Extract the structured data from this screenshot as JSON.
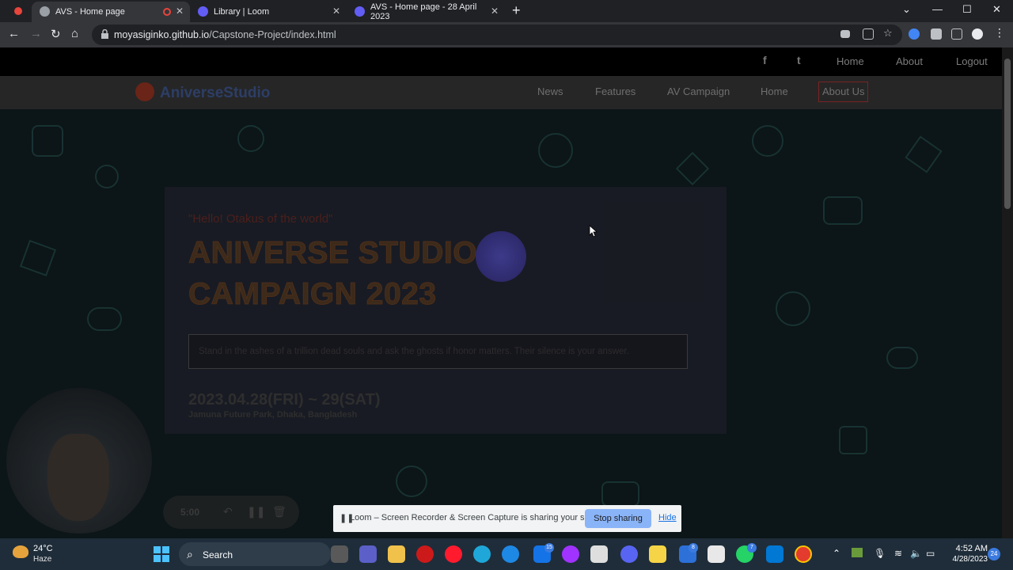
{
  "browser": {
    "tabs": [
      {
        "title": "AVS - Home page",
        "active": true
      },
      {
        "title": "Library | Loom",
        "active": false
      },
      {
        "title": "AVS - Home page - 28 April 2023",
        "active": false
      }
    ],
    "url_host": "moyasiginko.github.io",
    "url_path": "/Capstone-Project/index.html"
  },
  "site": {
    "topbar": {
      "social": [
        "f",
        "t"
      ],
      "links": [
        "Home",
        "About",
        "Logout"
      ]
    },
    "brand": "AniverseStudio",
    "nav": [
      "News",
      "Features",
      "AV Campaign",
      "Home",
      "About Us"
    ],
    "hero": {
      "greeting": "\"Hello! Otakus of the world\"",
      "title_line1": "ANIVERSE STUDIO",
      "title_line2": "CAMPAIGN 2023",
      "quote": "Stand in the ashes of a trillion dead souls and ask the ghosts if honor matters. Their silence is your answer.",
      "date": "2023.04.28(FRI) ~ 29(SAT)",
      "location": "Jamuna Future Park, Dhaka, Bangladesh"
    }
  },
  "loom": {
    "timer": "5:00",
    "share_message": "Loom – Screen Recorder & Screen Capture is sharing your screen.",
    "stop_label": "Stop sharing",
    "hide_label": "Hide"
  },
  "taskbar": {
    "temperature": "24°C",
    "weather": "Haze",
    "search_label": "Search",
    "badge_mail": "15",
    "badge_todo": "8",
    "badge_whatsapp": "7",
    "time": "4:52 AM",
    "date": "4/28/2023",
    "notifications": "24"
  }
}
